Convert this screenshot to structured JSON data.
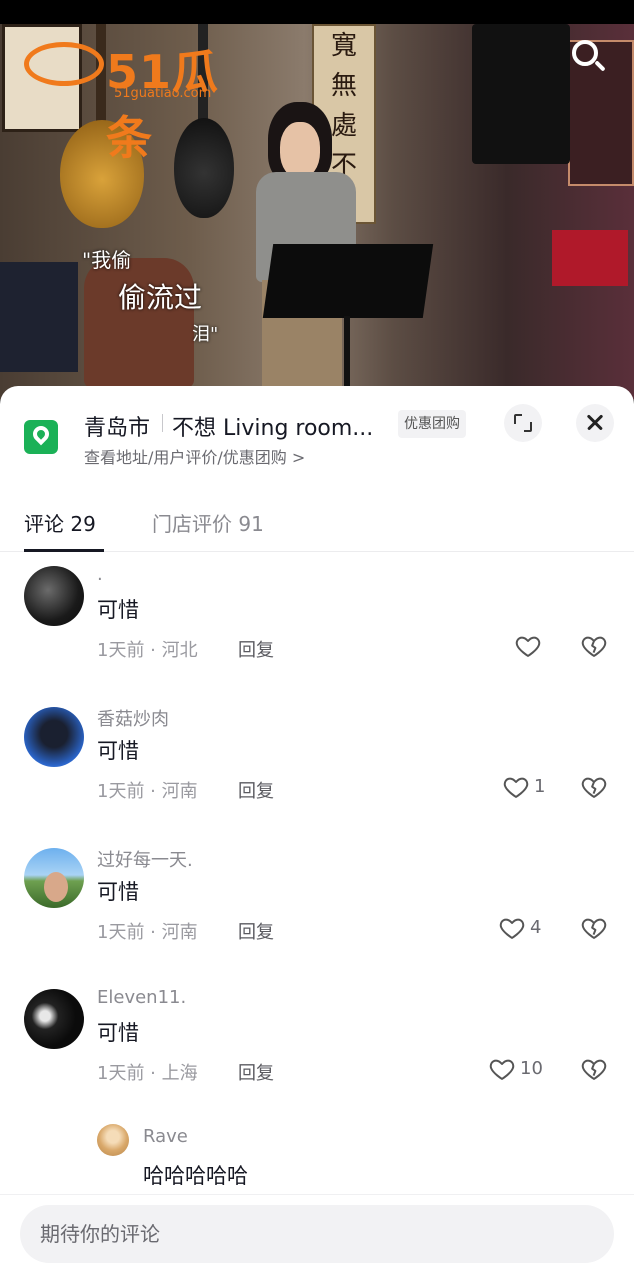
{
  "video": {
    "logo_brand": "51瓜条",
    "logo_url": "51guatiao.com",
    "sign_text": [
      "寬",
      "無",
      "處",
      "不"
    ],
    "lyrics": [
      "\"我偷",
      "偷流过",
      "泪\""
    ]
  },
  "poi": {
    "city": "青岛市",
    "name": "不想 Living room...",
    "badge": "优惠团购",
    "subtitle": "查看地址/用户评价/优惠团购 >"
  },
  "tabs": {
    "comments": "评论 29",
    "reviews": "门店评价 91"
  },
  "comments": [
    {
      "user": ".",
      "text": "可惜",
      "meta": "1天前 · 河北",
      "reply": "回复",
      "likes": ""
    },
    {
      "user": "香菇炒肉",
      "text": "可惜",
      "meta": "1天前 · 河南",
      "reply": "回复",
      "likes": "1"
    },
    {
      "user": "过好每一天.",
      "text": "可惜",
      "meta": "1天前 · 河南",
      "reply": "回复",
      "likes": "4"
    },
    {
      "user": "Eleven11.",
      "text": "可惜",
      "meta": "1天前 · 上海",
      "reply": "回复",
      "likes": "10"
    }
  ],
  "reply": {
    "user": "Rave",
    "text": "哈哈哈哈哈"
  },
  "input": {
    "placeholder": "期待你的评论"
  },
  "colors": {
    "accent": "#161823",
    "poi_green": "#1bb157",
    "logo_orange": "#f07a1c"
  }
}
